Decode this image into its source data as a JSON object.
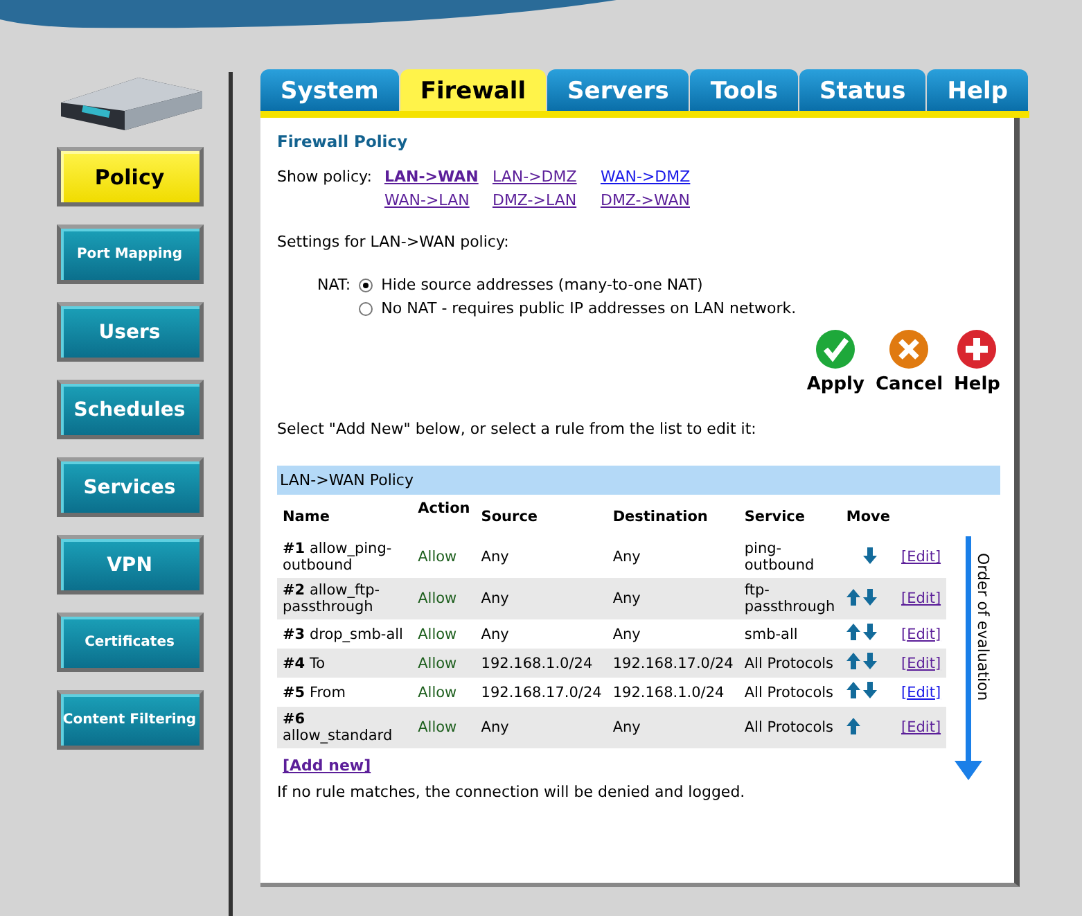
{
  "sidebar": {
    "items": [
      {
        "label": "Policy",
        "selected": true
      },
      {
        "label": "Port Mapping",
        "selected": false
      },
      {
        "label": "Users",
        "selected": false
      },
      {
        "label": "Schedules",
        "selected": false
      },
      {
        "label": "Services",
        "selected": false
      },
      {
        "label": "VPN",
        "selected": false
      },
      {
        "label": "Certificates",
        "selected": false
      },
      {
        "label": "Content Filtering",
        "selected": false
      }
    ]
  },
  "tabs": [
    {
      "label": "System",
      "selected": false
    },
    {
      "label": "Firewall",
      "selected": true
    },
    {
      "label": "Servers",
      "selected": false
    },
    {
      "label": "Tools",
      "selected": false
    },
    {
      "label": "Status",
      "selected": false
    },
    {
      "label": "Help",
      "selected": false
    }
  ],
  "panel": {
    "title": "Firewall Policy",
    "show_policy": {
      "label": "Show policy:",
      "links": [
        {
          "label": "LAN->WAN",
          "selected": true,
          "visited": true
        },
        {
          "label": "LAN->DMZ",
          "selected": false,
          "visited": true
        },
        {
          "label": "WAN->DMZ",
          "selected": false,
          "visited": false
        },
        {
          "label": "WAN->LAN",
          "selected": false,
          "visited": true
        },
        {
          "label": "DMZ->LAN",
          "selected": false,
          "visited": true
        },
        {
          "label": "DMZ->WAN",
          "selected": false,
          "visited": true
        }
      ]
    },
    "settings_heading": "Settings for LAN->WAN policy:",
    "nat": {
      "label": "NAT:",
      "options": [
        {
          "label": "Hide source addresses (many-to-one NAT)",
          "selected": true
        },
        {
          "label": "No NAT - requires public IP addresses on LAN network.",
          "selected": false
        }
      ]
    },
    "actions": [
      {
        "kind": "apply",
        "label": "Apply"
      },
      {
        "kind": "cancel",
        "label": "Cancel"
      },
      {
        "kind": "help",
        "label": "Help"
      }
    ],
    "instruction": "Select \"Add New\" below, or select a rule from the list to edit it:",
    "table": {
      "title": "LAN->WAN Policy",
      "columns": [
        "Name",
        "Action",
        "Source",
        "Destination",
        "Service",
        "Move"
      ],
      "rows": [
        {
          "name": "**#1** allow_ping-outbound",
          "action": "Allow",
          "source": "Any",
          "destination": "Any",
          "service": "ping-outbound",
          "move_up": false,
          "move_down": true,
          "edit": "[Edit]",
          "visited": true
        },
        {
          "name": "**#2** allow_ftp-passthrough",
          "action": "Allow",
          "source": "Any",
          "destination": "Any",
          "service": "ftp-passthrough",
          "move_up": true,
          "move_down": true,
          "edit": "[Edit]",
          "visited": true
        },
        {
          "name": "**#3** drop_smb-all",
          "action": "Allow",
          "source": "Any",
          "destination": "Any",
          "service": "smb-all",
          "move_up": true,
          "move_down": true,
          "edit": "[Edit]",
          "visited": true
        },
        {
          "name": "**#4** To",
          "action": "Allow",
          "source": "192.168.1.0/24",
          "destination": "192.168.17.0/24",
          "service": "All Protocols",
          "move_up": true,
          "move_down": true,
          "edit": "[Edit]",
          "visited": true
        },
        {
          "name": "**#5** From",
          "action": "Allow",
          "source": "192.168.17.0/24",
          "destination": "192.168.1.0/24",
          "service": "All Protocols",
          "move_up": true,
          "move_down": true,
          "edit": "[Edit]",
          "visited": false
        },
        {
          "name": "**#6** allow_standard",
          "action": "Allow",
          "source": "Any",
          "destination": "Any",
          "service": "All Protocols",
          "move_up": true,
          "move_down": false,
          "edit": "[Edit]",
          "visited": true
        }
      ],
      "order_label": "Order of evaluation"
    },
    "add_new": "[Add new]",
    "footer_note": "If no rule matches, the connection will be denied and logged."
  }
}
